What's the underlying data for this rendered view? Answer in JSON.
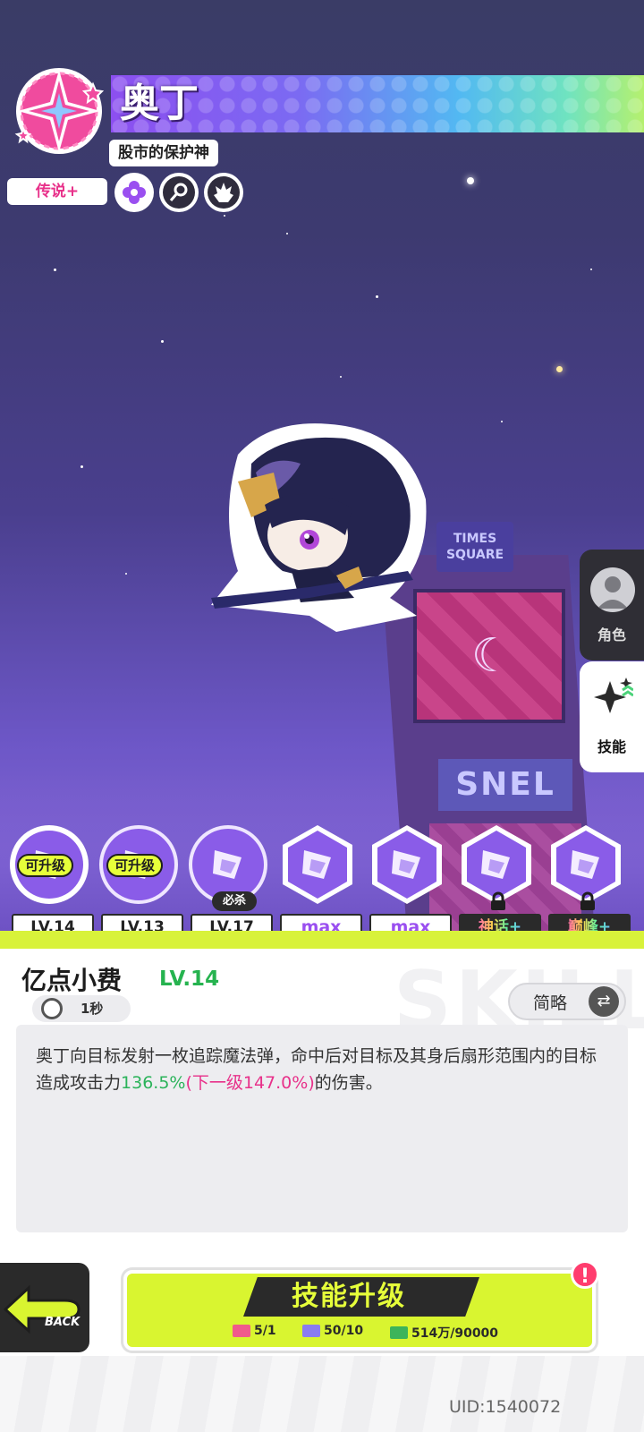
{
  "hero": {
    "name": "奥丁",
    "title": "股市的保护神",
    "rarity": "传说+",
    "traits": [
      "flower-icon",
      "key-icon",
      "flame-icon"
    ]
  },
  "side_tabs": {
    "role": "角色",
    "skill": "技能"
  },
  "skills": [
    {
      "level": "LV.14",
      "tag": "可升级",
      "selected": true
    },
    {
      "level": "LV.13",
      "tag": "可升级"
    },
    {
      "level": "LV.17",
      "tag": "必杀"
    },
    {
      "level": "max"
    },
    {
      "level": "max"
    },
    {
      "level": "神话+",
      "locked": true
    },
    {
      "level": "巅峰+",
      "locked": true
    }
  ],
  "detail": {
    "name": "亿点小费",
    "level": "LV.14",
    "cooldown": "1秒",
    "brief_label": "简略",
    "desc_part1": "奥丁向目标发射一枚追踪魔法弹，命中后对目标及其身后扇形范围内的目标造成攻击力",
    "desc_value": "136.5%",
    "desc_next": "(下一级147.0%)",
    "desc_part2": "的伤害。"
  },
  "scene": {
    "sign_top": "TIMES SQUARE",
    "sign_bottom": "SNEL"
  },
  "bottom": {
    "back_label": "BACK",
    "upgrade_label": "技能升级",
    "alert": "!",
    "costs": [
      {
        "value": "5/1",
        "color": "#f05a8c"
      },
      {
        "value": "50/10",
        "color": "#8a7cf0"
      },
      {
        "value": "514万/90000",
        "color": "#3cb45a"
      }
    ],
    "uid": "UID:1540072"
  },
  "colors": {
    "accent_lime": "#d9f530",
    "rarity_pink": "#e8318a",
    "level_green": "#26b34f"
  }
}
